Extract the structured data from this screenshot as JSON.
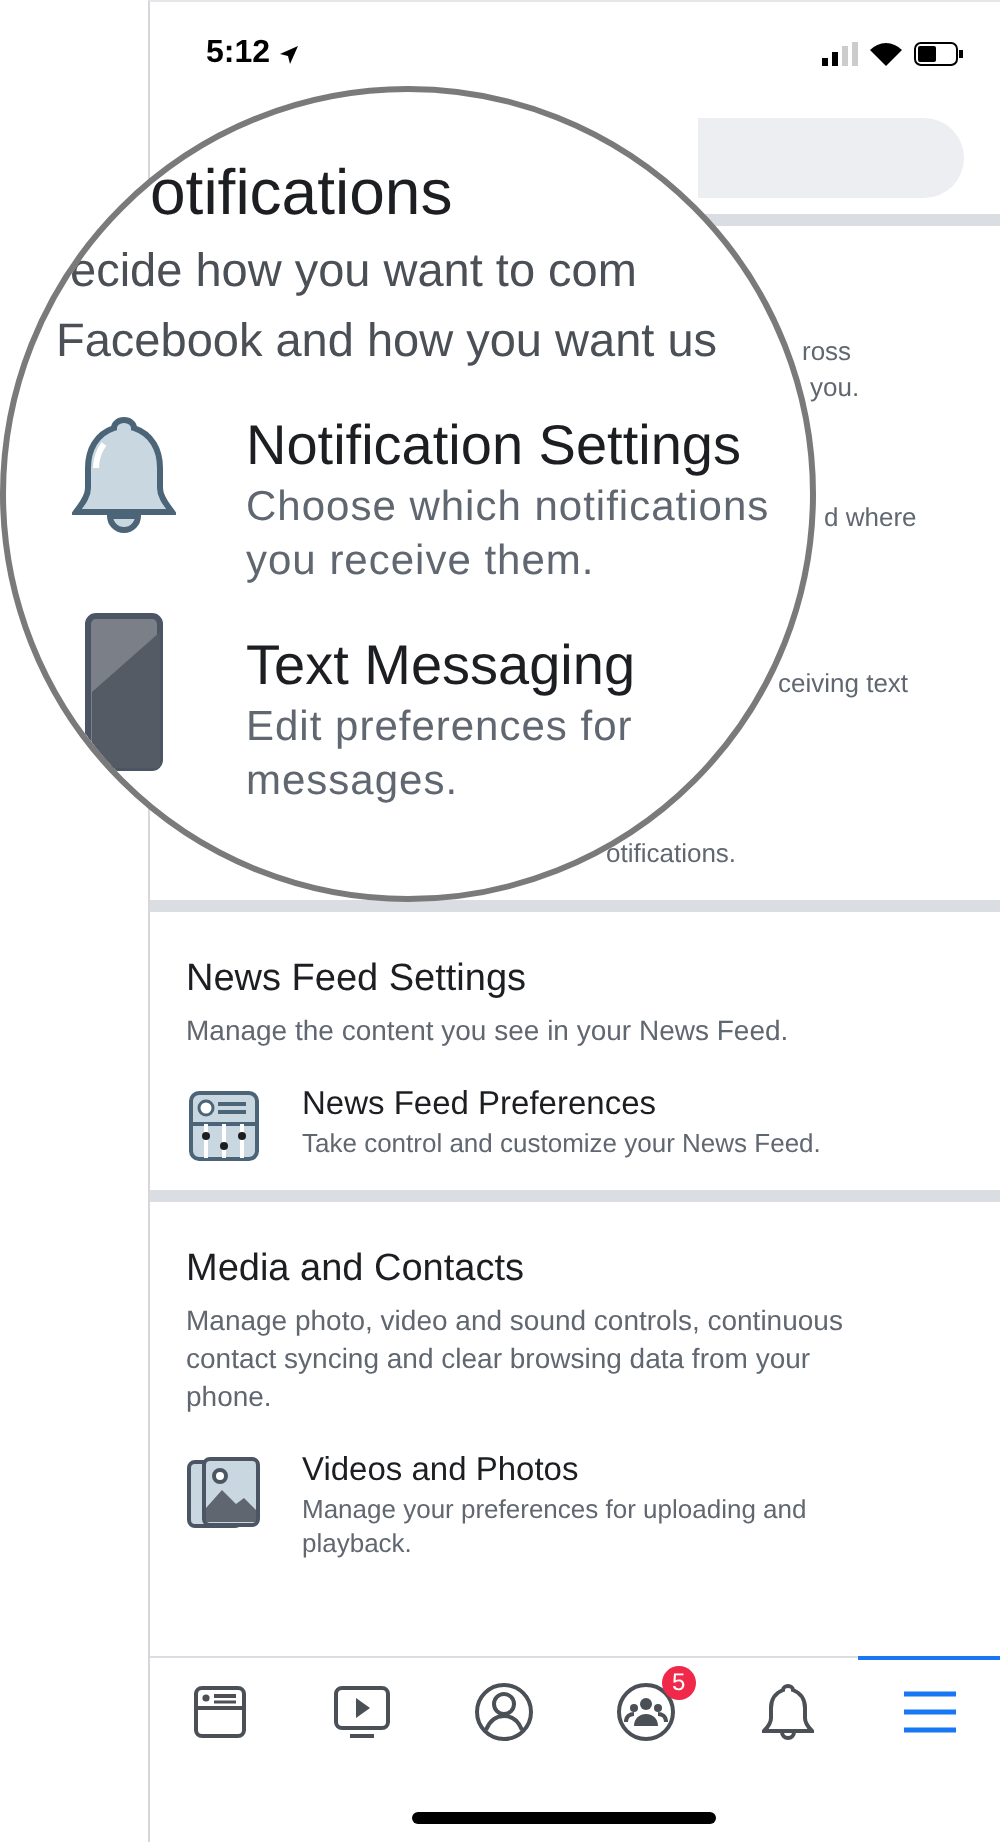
{
  "status_bar": {
    "time": "5:12"
  },
  "magnifier": {
    "heading": "otifications",
    "description_lines": [
      "ecide how you want to com",
      "Facebook and how you want us"
    ],
    "items": [
      {
        "kind": "bell",
        "title": "Notification Settings",
        "lines": [
          "Choose which notifications",
          "you receive them."
        ]
      },
      {
        "kind": "phone",
        "title": "Text Messaging",
        "lines": [
          "Edit preferences for",
          "messages."
        ]
      }
    ]
  },
  "notification_fragments": [
    "ross",
    "you.",
    "d where",
    "ceiving text",
    "otifications."
  ],
  "sections": [
    {
      "title": "News Feed Settings",
      "description_lines": [
        "Manage the content you see in your News Feed."
      ],
      "items": [
        {
          "kind": "feed",
          "title": "News Feed Preferences",
          "lines": [
            "Take control and customize your News Feed."
          ]
        }
      ]
    },
    {
      "title": "Media and Contacts",
      "description_lines": [
        "Manage photo, video and sound controls, continuous",
        "contact syncing and clear browsing data from your",
        "phone."
      ],
      "items": [
        {
          "kind": "photos",
          "title": "Videos and Photos",
          "lines": [
            "Manage your preferences for uploading and",
            "playback."
          ]
        }
      ]
    }
  ],
  "tab_bar": [
    {
      "kind": "feed",
      "selected": false
    },
    {
      "kind": "watch",
      "selected": false
    },
    {
      "kind": "profile",
      "selected": false
    },
    {
      "kind": "groups",
      "selected": false,
      "badge": "5"
    },
    {
      "kind": "bell",
      "selected": false
    },
    {
      "kind": "menu",
      "selected": true
    }
  ]
}
